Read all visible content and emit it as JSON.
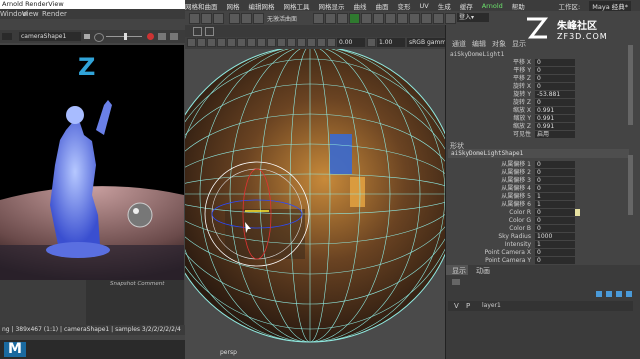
{
  "menubar": {
    "items": [
      "网格和曲面",
      "网格",
      "编辑网格",
      "网格工具",
      "网格显示",
      "曲线",
      "曲面",
      "变形",
      "UV",
      "生成",
      "缓存",
      "Arnold",
      "帮助"
    ],
    "workspace": "工作区:",
    "workspace_value": "Maya 经典*"
  },
  "toolbar": {
    "group_field": "无活动对象",
    "live_surface": "无激活曲面"
  },
  "viewport_toolbar": {
    "field1": "0.00",
    "field2": "1.00",
    "field3": "sRGB gamma"
  },
  "render_view": {
    "title": "Arnold RenderView",
    "menu": [
      "Window",
      "View",
      "Render"
    ],
    "camera": "cameraShape1",
    "snapshot_caption": "Snapshot Comment",
    "status": "ng | 389x467 (1:1) | cameraShape1 | samples 3/2/2/2/2/2/4"
  },
  "attribute_editor": {
    "tabs": [
      "通道",
      "编辑",
      "对象",
      "显示"
    ],
    "node_name": "aiSkyDomeLight1",
    "transform_rows": [
      {
        "label": "平移 X",
        "value": "0"
      },
      {
        "label": "平移 Y",
        "value": "0"
      },
      {
        "label": "平移 Z",
        "value": "0"
      },
      {
        "label": "旋转 X",
        "value": "0"
      },
      {
        "label": "旋转 Y",
        "value": "-53.881"
      },
      {
        "label": "旋转 Z",
        "value": "0"
      },
      {
        "label": "缩放 X",
        "value": "0.991"
      },
      {
        "label": "缩放 Y",
        "value": "0.991"
      },
      {
        "label": "缩放 Z",
        "value": "0.991"
      },
      {
        "label": "可见性",
        "value": "启用"
      }
    ],
    "shape_header": "形状",
    "shape_name": "aiSkyDomeLightShape1",
    "shape_rows": [
      {
        "label": "从属偏移 1",
        "value": "0"
      },
      {
        "label": "从属偏移 2",
        "value": "0"
      },
      {
        "label": "从属偏移 3",
        "value": "0"
      },
      {
        "label": "从属偏移 4",
        "value": "0"
      },
      {
        "label": "从属偏移 5",
        "value": "1"
      },
      {
        "label": "从属偏移 6",
        "value": "1"
      },
      {
        "label": "Color R",
        "value": "0"
      },
      {
        "label": "Color G",
        "value": "0"
      },
      {
        "label": "Color B",
        "value": "0"
      },
      {
        "label": "Sky Radius",
        "value": "1000"
      },
      {
        "label": "Intensity",
        "value": "1"
      },
      {
        "label": "Point Camera X",
        "value": "0"
      },
      {
        "label": "Point Camera Y",
        "value": "0"
      }
    ]
  },
  "layers": {
    "tabs": [
      "显示",
      "动画"
    ],
    "row_v": "V",
    "row_p": "P",
    "layer_name": "layer1"
  },
  "watermark": {
    "brand": "朱峰社区",
    "url": "ZF3D.COM"
  },
  "colors": {
    "viewport_bg": "#4a4a4a",
    "wire": "#8fe9e0",
    "sphere": "#6a4a2a",
    "menu_bg": "#3c3c3c",
    "render_bg": "#000000",
    "highlight": "#2a8ad5"
  }
}
